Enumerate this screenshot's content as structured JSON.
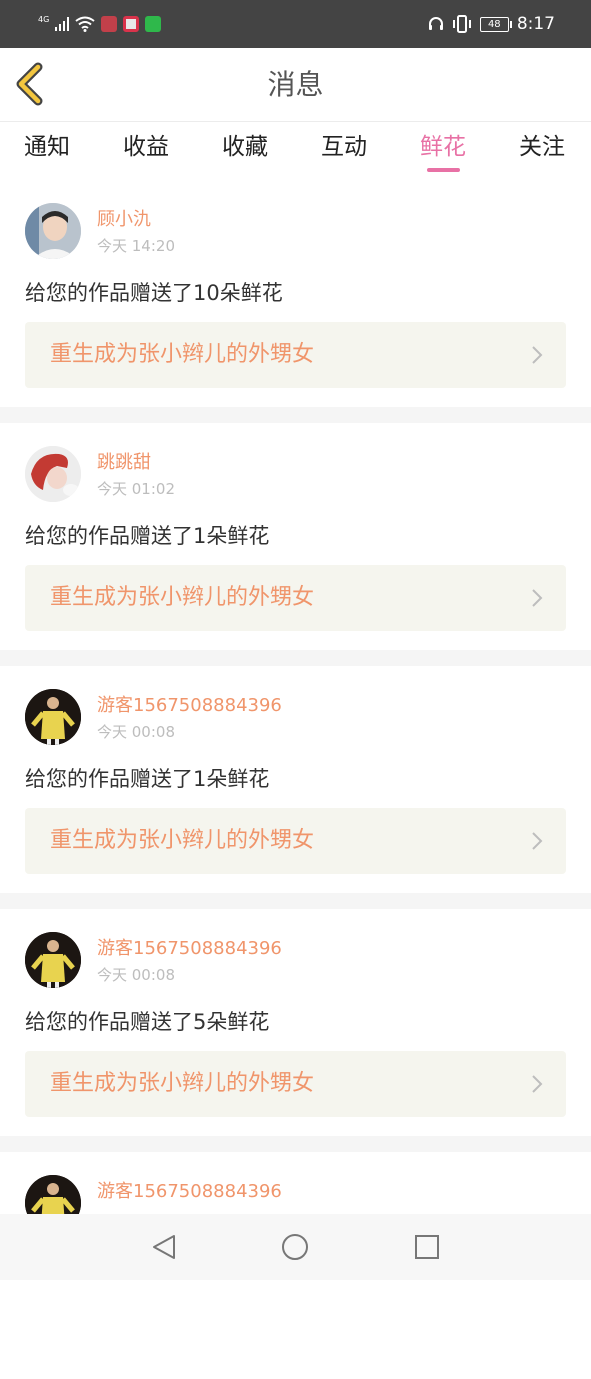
{
  "status_bar": {
    "network": "4G",
    "battery": "48",
    "time": "8:17"
  },
  "header": {
    "title": "消息"
  },
  "tabs": [
    {
      "label": "通知"
    },
    {
      "label": "收益"
    },
    {
      "label": "收藏"
    },
    {
      "label": "互动"
    },
    {
      "label": "鲜花",
      "active": true
    },
    {
      "label": "关注"
    }
  ],
  "messages": [
    {
      "username": "顾小氿",
      "time": "今天 14:20",
      "text": "给您的作品赠送了10朵鲜花",
      "work_title": "重生成为张小辫儿的外甥女"
    },
    {
      "username": "跳跳甜",
      "time": "今天 01:02",
      "text": "给您的作品赠送了1朵鲜花",
      "work_title": "重生成为张小辫儿的外甥女"
    },
    {
      "username": "游客1567508884396",
      "time": "今天 00:08",
      "text": "给您的作品赠送了1朵鲜花",
      "work_title": "重生成为张小辫儿的外甥女"
    },
    {
      "username": "游客1567508884396",
      "time": "今天 00:08",
      "text": "给您的作品赠送了5朵鲜花",
      "work_title": "重生成为张小辫儿的外甥女"
    },
    {
      "username": "游客1567508884396"
    }
  ],
  "colors": {
    "accent_pink": "#e871a5",
    "username_orange": "#f0956b",
    "work_bg": "#f5f5ee",
    "status_bar_bg": "#444444"
  },
  "icons": {
    "back": "chevron-left-icon",
    "work_arrow": "chevron-right-icon",
    "nav_back": "triangle-back-icon",
    "nav_home": "circle-home-icon",
    "nav_recents": "square-recents-icon"
  }
}
